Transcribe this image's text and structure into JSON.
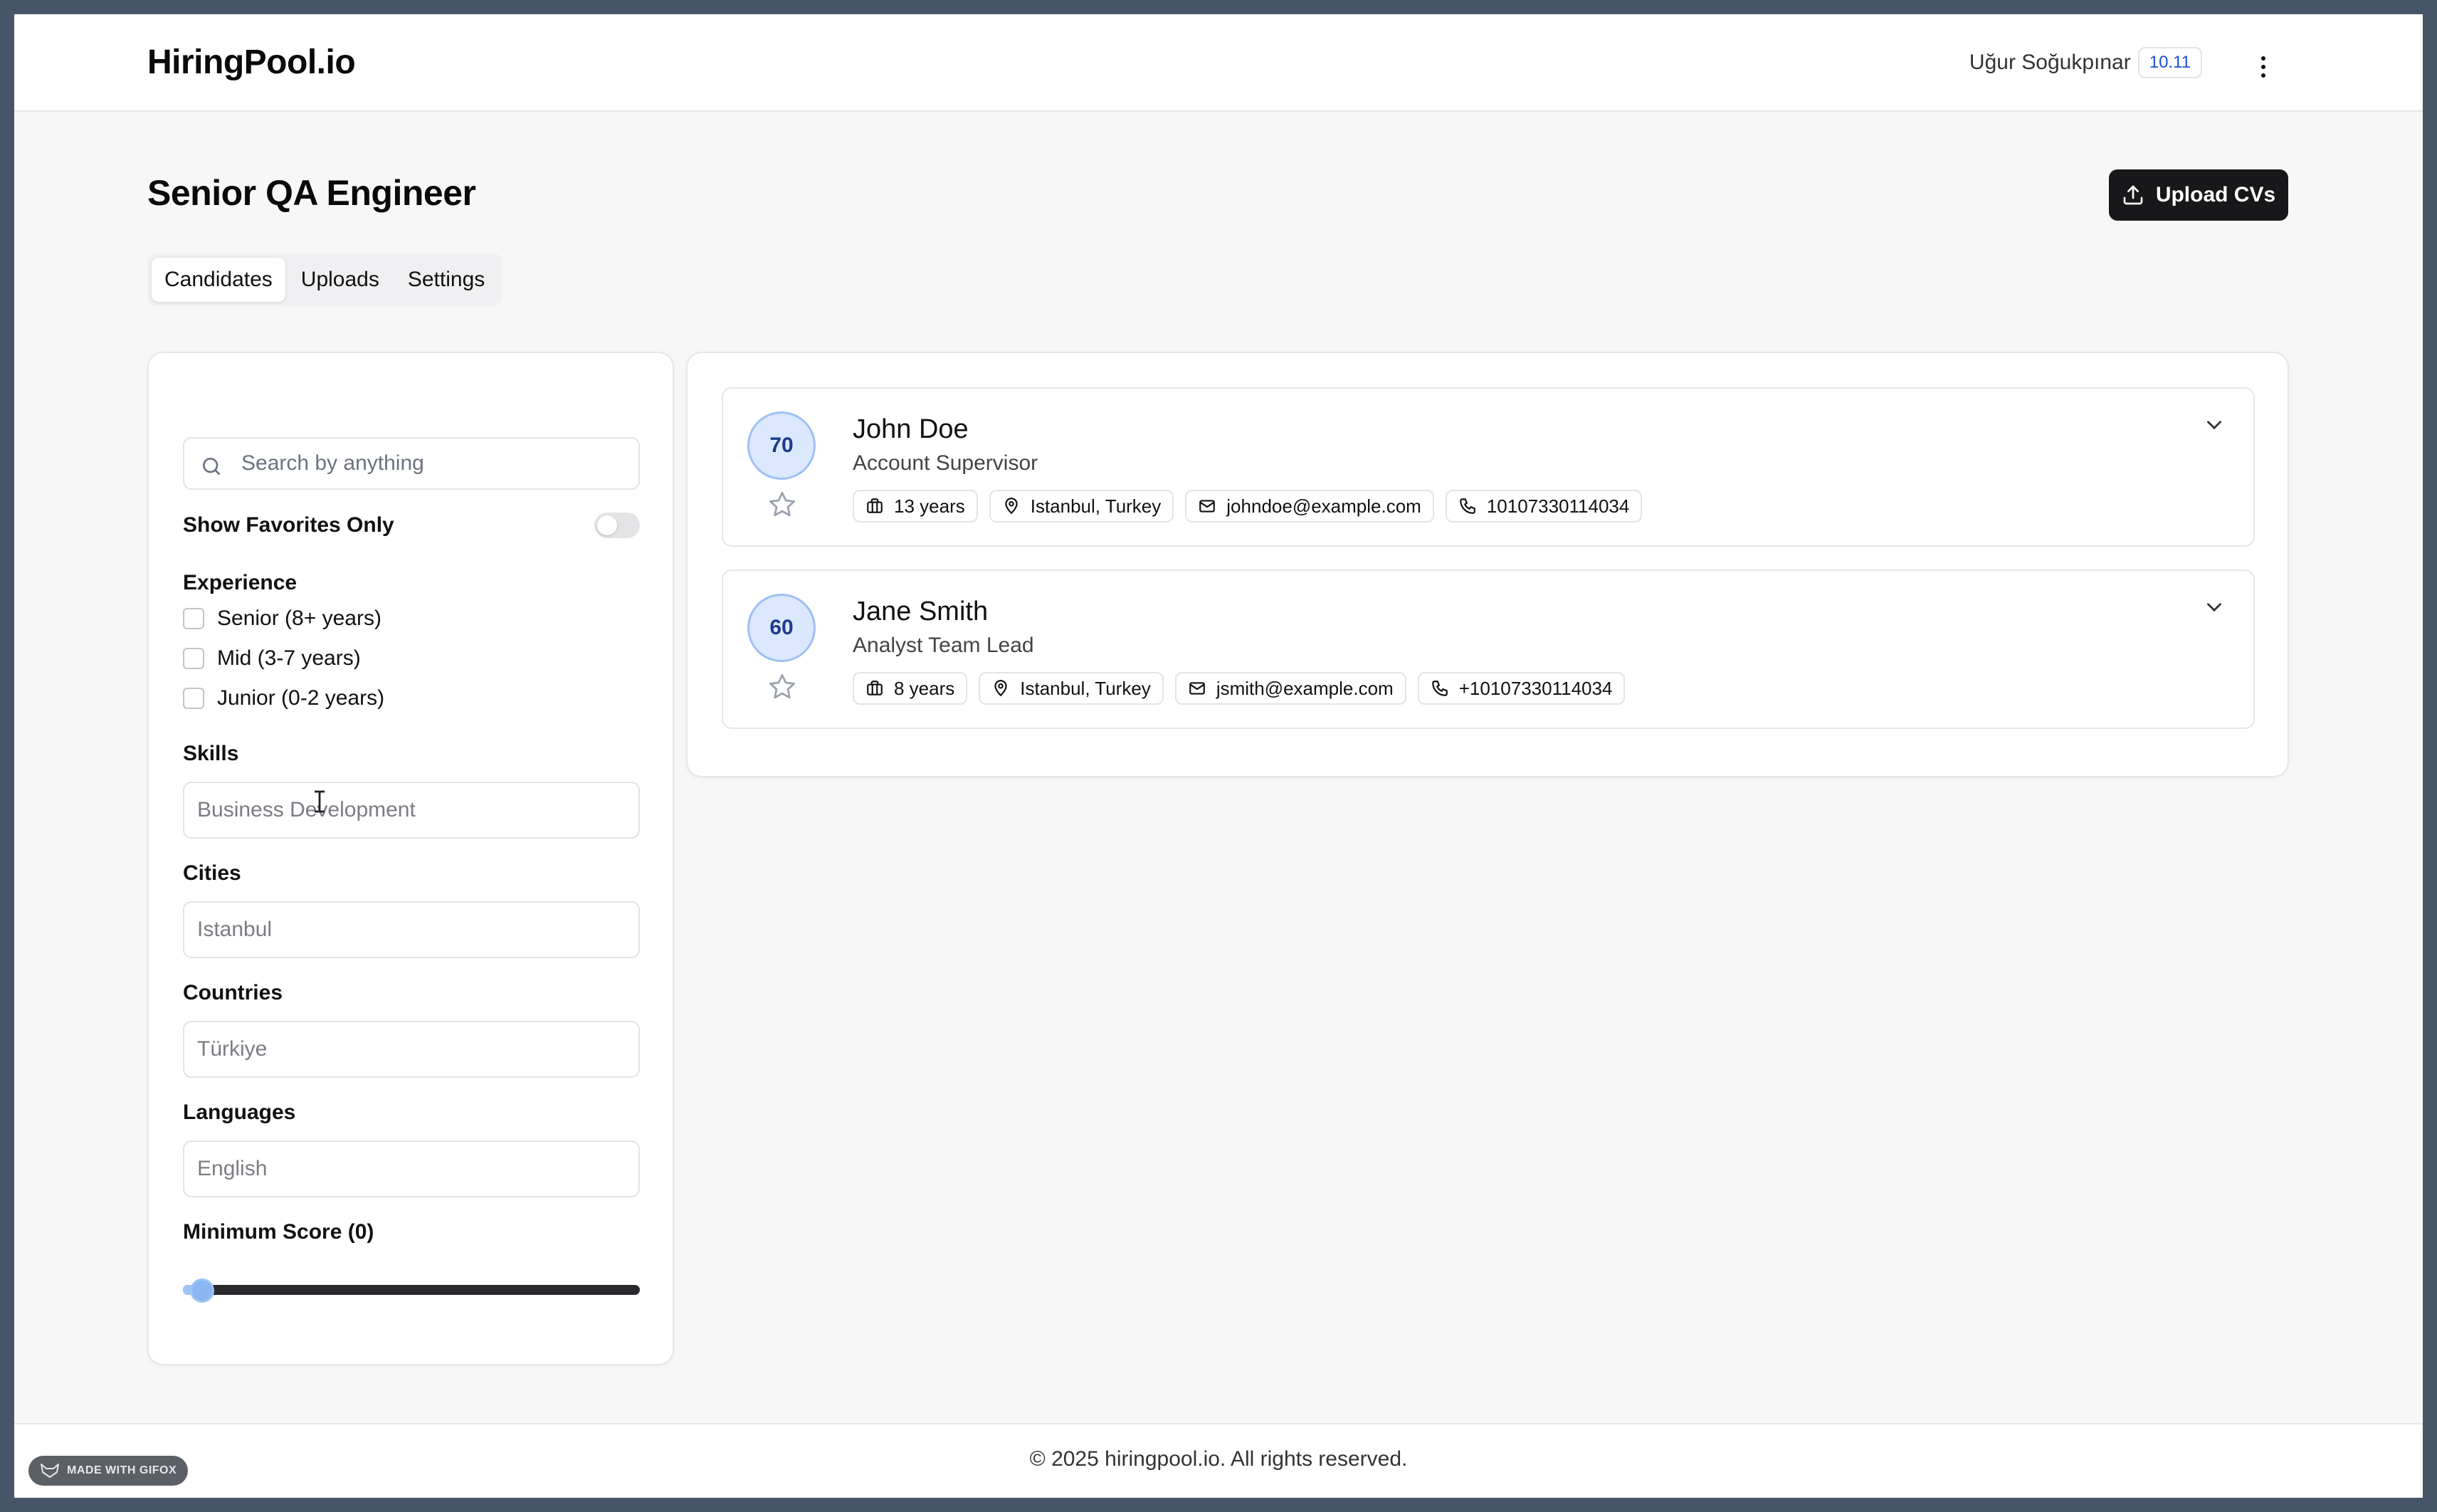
{
  "header": {
    "logo": "HiringPool.io",
    "user_name": "Uğur Soğukpınar",
    "version": "10.11",
    "menu_icon": "more-vertical-icon"
  },
  "page": {
    "title": "Senior QA Engineer",
    "upload_button": "Upload CVs",
    "upload_icon": "upload-icon"
  },
  "tabs": [
    {
      "label": "Candidates",
      "active": true
    },
    {
      "label": "Uploads",
      "active": false
    },
    {
      "label": "Settings",
      "active": false
    }
  ],
  "filters": {
    "search": {
      "placeholder": "Search by anything",
      "value": "",
      "icon": "search-icon"
    },
    "favorites_label": "Show Favorites Only",
    "favorites_on": false,
    "experience": {
      "label": "Experience",
      "options": [
        "Senior (8+ years)",
        "Mid (3-7 years)",
        "Junior (0-2 years)"
      ]
    },
    "skills": {
      "label": "Skills",
      "placeholder": "Business Development"
    },
    "cities": {
      "label": "Cities",
      "placeholder": "Istanbul"
    },
    "countries": {
      "label": "Countries",
      "placeholder": "Türkiye"
    },
    "languages": {
      "label": "Languages",
      "placeholder": "English"
    },
    "min_score": {
      "label": "Minimum Score (0)",
      "value": 0,
      "min": 0,
      "max": 100
    }
  },
  "candidates": [
    {
      "score": "70",
      "name": "John Doe",
      "title": "Account Supervisor",
      "experience": "13 years",
      "location": "Istanbul, Turkey",
      "email": "johndoe@example.com",
      "phone": "10107330114034"
    },
    {
      "score": "60",
      "name": "Jane Smith",
      "title": "Analyst Team Lead",
      "experience": "8 years",
      "location": "Istanbul, Turkey",
      "email": "jsmith@example.com",
      "phone": "+10107330114034"
    }
  ],
  "footer": {
    "copyright": "© 2025 hiringpool.io. All rights reserved.",
    "badge": "MADE WITH GIFOX"
  },
  "colors": {
    "primary_button": "#18181b",
    "score_bg": "#dbe8fd",
    "score_text": "#1e3a8a",
    "version_text": "#1d4ed8",
    "slider_thumb": "#8bb6f2"
  }
}
